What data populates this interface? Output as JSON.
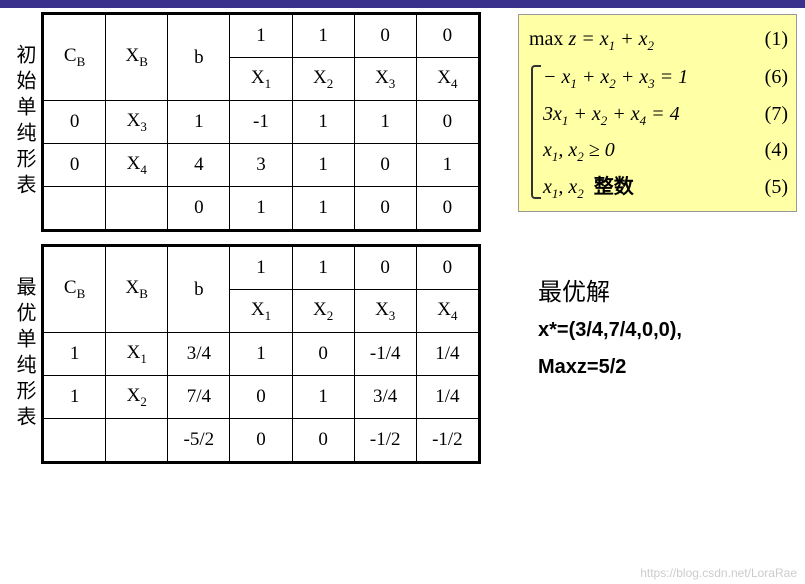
{
  "labels": {
    "table1_title": "初始单纯形表",
    "table2_title": "最优单纯形表",
    "CB": "C",
    "XB": "X",
    "b": "b",
    "X1": "X",
    "X2": "X",
    "X3": "X",
    "X4": "X"
  },
  "table1": {
    "obj": [
      "1",
      "1",
      "0",
      "0"
    ],
    "vars": [
      "X₁",
      "X₂",
      "X₃",
      "X₄"
    ],
    "rows": [
      {
        "cb": "0",
        "xb": "X₃",
        "b": "1",
        "vals": [
          "-1",
          "1",
          "1",
          "0"
        ]
      },
      {
        "cb": "0",
        "xb": "X₄",
        "b": "4",
        "vals": [
          "3",
          "1",
          "0",
          "1"
        ]
      }
    ],
    "zrow": [
      "0",
      "1",
      "1",
      "0",
      "0"
    ]
  },
  "table2": {
    "obj": [
      "1",
      "1",
      "0",
      "0"
    ],
    "vars": [
      "X₁",
      "X₂",
      "X₃",
      "X₄"
    ],
    "rows": [
      {
        "cb": "1",
        "xb": "X₁",
        "b": "3/4",
        "vals": [
          "1",
          "0",
          "-1/4",
          "1/4"
        ]
      },
      {
        "cb": "1",
        "xb": "X₂",
        "b": "7/4",
        "vals": [
          "0",
          "1",
          "3/4",
          "1/4"
        ]
      }
    ],
    "zrow": [
      "-5/2",
      "0",
      "0",
      "-1/2",
      "-1/2"
    ]
  },
  "formulas": {
    "f1": "max z = x₁ + x₂",
    "n1": "(1)",
    "f2": "− x₁ + x₂ + x₃ = 1",
    "n2": "(6)",
    "f3": "3x₁ + x₂ + x₄ = 4",
    "n3": "(7)",
    "f4": "x₁, x₂ ≥ 0",
    "n4": "(4)",
    "f5a": "x₁, x₂",
    "f5b": "整数",
    "n5": "(5)"
  },
  "solution": {
    "title": "最优解",
    "line1": "x*=(3/4,7/4,0,0),",
    "line2": "Maxz=5/2"
  },
  "watermark": "https://blog.csdn.net/LoraRae",
  "chart_data": [
    {
      "type": "table",
      "title": "初始单纯形表 (Initial Simplex Tableau)",
      "columns": [
        "C_B",
        "X_B",
        "b",
        "X1",
        "X2",
        "X3",
        "X4"
      ],
      "objective_row": [
        null,
        null,
        null,
        1,
        1,
        0,
        0
      ],
      "rows": [
        [
          0,
          "X3",
          1,
          -1,
          1,
          1,
          0
        ],
        [
          0,
          "X4",
          4,
          3,
          1,
          0,
          1
        ]
      ],
      "z_row": [
        null,
        null,
        0,
        1,
        1,
        0,
        0
      ]
    },
    {
      "type": "table",
      "title": "最优单纯形表 (Optimal Simplex Tableau)",
      "columns": [
        "C_B",
        "X_B",
        "b",
        "X1",
        "X2",
        "X3",
        "X4"
      ],
      "objective_row": [
        null,
        null,
        null,
        1,
        1,
        0,
        0
      ],
      "rows": [
        [
          1,
          "X1",
          0.75,
          1,
          0,
          -0.25,
          0.25
        ],
        [
          1,
          "X2",
          1.75,
          0,
          1,
          0.75,
          0.25
        ]
      ],
      "z_row": [
        null,
        null,
        -2.5,
        0,
        0,
        -0.5,
        -0.5
      ]
    }
  ]
}
